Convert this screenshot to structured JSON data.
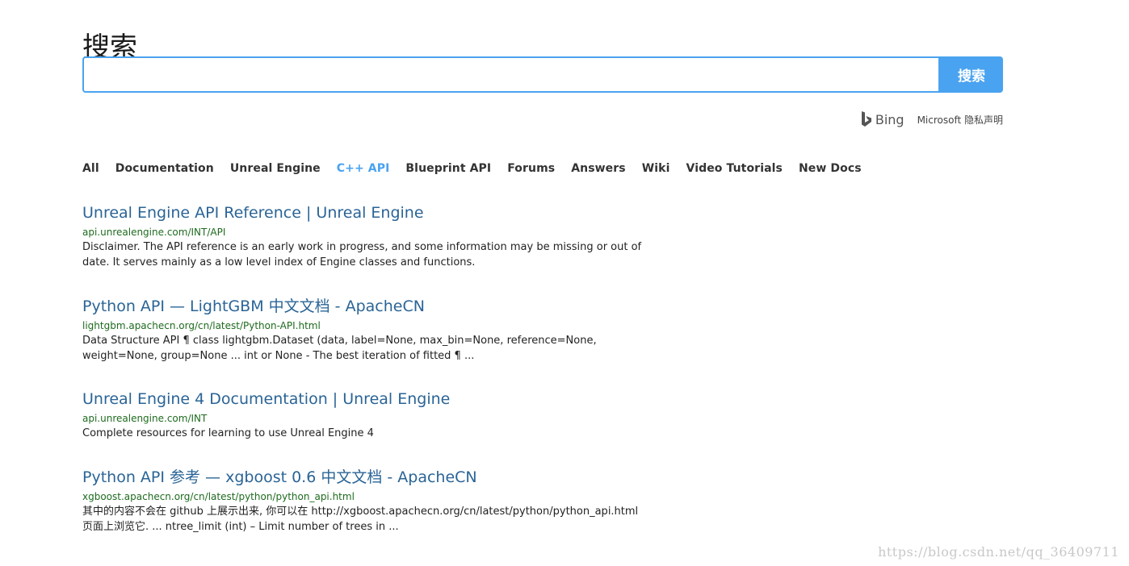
{
  "page": {
    "title": "搜索"
  },
  "search": {
    "value": "",
    "placeholder": "",
    "button_label": "搜索"
  },
  "bing": {
    "brand": "Bing",
    "privacy_link": "Microsoft 隐私声明"
  },
  "tabs": [
    {
      "label": "All",
      "active": false
    },
    {
      "label": "Documentation",
      "active": false
    },
    {
      "label": "Unreal Engine",
      "active": false
    },
    {
      "label": "C++ API",
      "active": true
    },
    {
      "label": "Blueprint API",
      "active": false
    },
    {
      "label": "Forums",
      "active": false
    },
    {
      "label": "Answers",
      "active": false
    },
    {
      "label": "Wiki",
      "active": false
    },
    {
      "label": "Video Tutorials",
      "active": false
    },
    {
      "label": "New Docs",
      "active": false
    }
  ],
  "results": [
    {
      "title": "Unreal Engine API Reference | Unreal Engine",
      "url": "api.unrealengine.com/INT/API",
      "snippet": "Disclaimer. The API reference is an early work in progress, and some information may be missing or out of date. It serves mainly as a low level index of Engine classes and functions."
    },
    {
      "title": "Python API — LightGBM 中文文档 - ApacheCN",
      "url": "lightgbm.apachecn.org/cn/latest/Python-API.html",
      "snippet": "Data Structure API ¶ class lightgbm.Dataset (data, label=None, max_bin=None, reference=None, weight=None, group=None ... int or None - The best iteration of fitted ¶ ..."
    },
    {
      "title": "Unreal Engine 4 Documentation | Unreal Engine",
      "url": "api.unrealengine.com/INT",
      "snippet": "Complete resources for learning to use Unreal Engine 4"
    },
    {
      "title": "Python API 参考 — xgboost 0.6 中文文档 - ApacheCN",
      "url": "xgboost.apachecn.org/cn/latest/python/python_api.html",
      "snippet": "其中的内容不会在 github 上展示出来, 你可以在 http://xgboost.apachecn.org/cn/latest/python/python_api.html 页面上浏览它. ... ntree_limit (int) – Limit number of trees in ..."
    }
  ],
  "watermark": "https://blog.csdn.net/qq_36409711",
  "colors": {
    "accent": "#4aa3f0",
    "link": "#2a6496",
    "url": "#1e6b1e"
  }
}
